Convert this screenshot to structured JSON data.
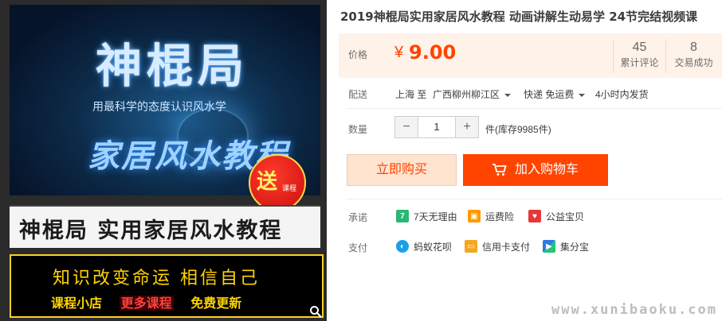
{
  "image": {
    "brand_title": "神棍局",
    "slogan": "用最科学的态度认识风水学",
    "subtitle": "家居风水教程",
    "gift_badge": {
      "main": "送",
      "sub": "课程"
    },
    "banner_text": "神棍局  实用家居风水教程",
    "promo_line1": "知识改变命运  相信自己",
    "promo_line2": [
      "课程小店",
      "更多课程",
      "免费更新"
    ],
    "zoom_icon": "magnifier-icon"
  },
  "product": {
    "title": "2019神棍局实用家居风水教程 动画讲解生动易学 24节完结视频课"
  },
  "price": {
    "label": "价格",
    "currency": "¥",
    "value": "9.00"
  },
  "stats": {
    "reviews_count": "45",
    "reviews_label": "累计评论",
    "sales_count": "8",
    "sales_label": "交易成功"
  },
  "shipping": {
    "label": "配送",
    "from": "上海 至",
    "to": "广西柳州柳江区",
    "method": "快递 免运费",
    "time": "4小时内发货"
  },
  "quantity": {
    "label": "数量",
    "value": "1",
    "minus": "−",
    "plus": "+",
    "stock": "件(库存9985件)"
  },
  "actions": {
    "buy_now": "立即购买",
    "add_to_cart": "加入购物车"
  },
  "guarantee": {
    "label": "承诺",
    "items": [
      {
        "text": "7天无理由",
        "icon": "seven-day-icon",
        "badge": "7",
        "color": "#2bb673"
      },
      {
        "text": "运费险",
        "icon": "shipping-insurance-icon",
        "badge": "",
        "color": "#ff9900"
      },
      {
        "text": "公益宝贝",
        "icon": "charity-heart-icon",
        "badge": "",
        "color": "#e5383b"
      }
    ]
  },
  "payment": {
    "label": "支付",
    "items": [
      {
        "text": "蚂蚁花呗",
        "icon": "huabei-icon",
        "color": "#1aa0e8"
      },
      {
        "text": "信用卡支付",
        "icon": "credit-card-icon",
        "color": "#f5a623"
      },
      {
        "text": "集分宝",
        "icon": "jifenbao-icon",
        "color": "#2c7be5"
      }
    ]
  },
  "watermark": "www.xunibaoku.com",
  "colors": {
    "accent": "#ff4400",
    "price_bg": "#fff2e8",
    "buy_bg": "#ffe4d0"
  }
}
